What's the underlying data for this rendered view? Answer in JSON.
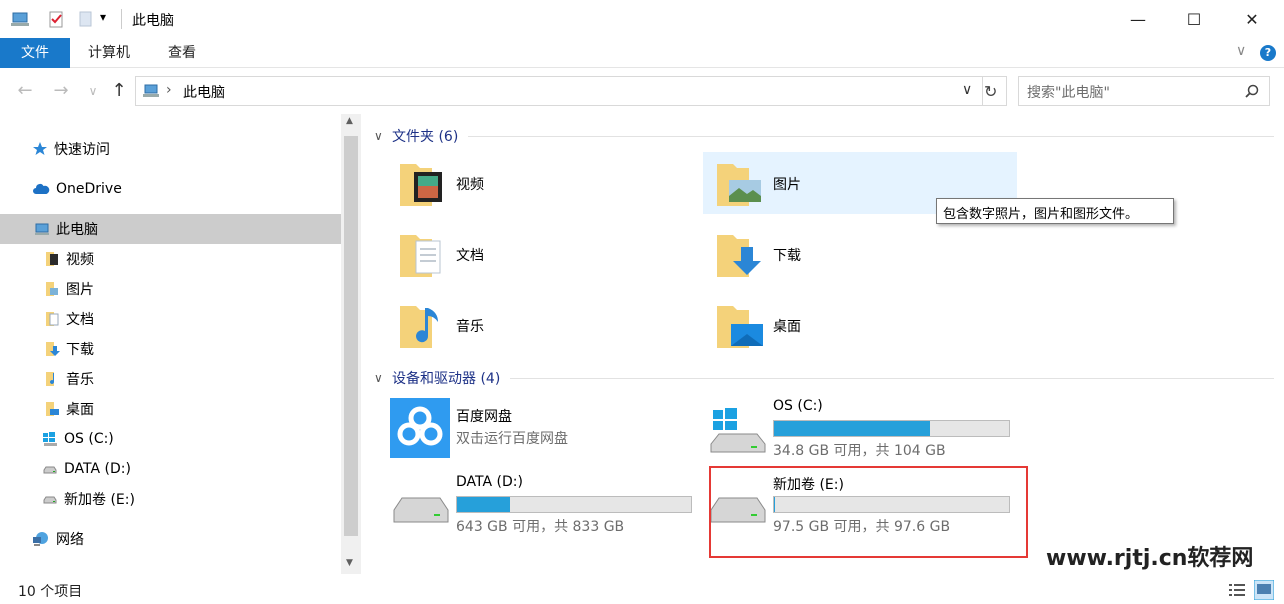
{
  "window": {
    "title": "此电脑",
    "minimize_glyph": "—",
    "maximize_glyph": "☐",
    "close_glyph": "✕",
    "qat_dropdown_glyph": "▾"
  },
  "ribbon": {
    "tabs": [
      "文件",
      "计算机",
      "查看"
    ],
    "expand_glyph": "∨",
    "help_glyph": "?"
  },
  "address": {
    "path": "此电脑",
    "separator": "›",
    "dropdown_glyph": "∨",
    "refresh_glyph": "↻",
    "search_placeholder": "搜索\"此电脑\"",
    "back_glyph": "←",
    "forward_glyph": "→",
    "recent_glyph": "∨",
    "up_glyph": "↑"
  },
  "sidebar": {
    "items": [
      {
        "label": "快速访问",
        "icon": "star-icon"
      },
      {
        "label": "OneDrive",
        "icon": "cloud-icon"
      },
      {
        "label": "此电脑",
        "icon": "computer-icon"
      },
      {
        "label": "视频",
        "icon": "videos-folder-icon"
      },
      {
        "label": "图片",
        "icon": "pictures-folder-icon"
      },
      {
        "label": "文档",
        "icon": "documents-folder-icon"
      },
      {
        "label": "下载",
        "icon": "downloads-folder-icon"
      },
      {
        "label": "音乐",
        "icon": "music-folder-icon"
      },
      {
        "label": "桌面",
        "icon": "desktop-folder-icon"
      },
      {
        "label": "OS (C:)",
        "icon": "windows-drive-icon"
      },
      {
        "label": "DATA (D:)",
        "icon": "drive-icon"
      },
      {
        "label": "新加卷 (E:)",
        "icon": "drive-icon"
      },
      {
        "label": "网络",
        "icon": "network-icon"
      }
    ],
    "scroll_up_glyph": "▲",
    "scroll_down_glyph": "▼"
  },
  "folders_group": {
    "title": "文件夹 (6)",
    "collapse_glyph": "∨",
    "items": [
      {
        "label": "视频",
        "icon": "videos-folder-icon"
      },
      {
        "label": "图片",
        "icon": "pictures-folder-icon"
      },
      {
        "label": "文档",
        "icon": "documents-folder-icon"
      },
      {
        "label": "下载",
        "icon": "downloads-folder-icon"
      },
      {
        "label": "音乐",
        "icon": "music-folder-icon"
      },
      {
        "label": "桌面",
        "icon": "desktop-folder-icon"
      }
    ]
  },
  "devices_group": {
    "title": "设备和驱动器 (4)",
    "collapse_glyph": "∨",
    "baidu": {
      "name": "百度网盘",
      "subtitle": "双击运行百度网盘"
    },
    "drives": [
      {
        "name": "OS (C:)",
        "info": "34.8 GB 可用，共 104 GB",
        "used_fraction": 0.665
      },
      {
        "name": "DATA (D:)",
        "info": "643 GB 可用，共 833 GB",
        "used_fraction": 0.228
      },
      {
        "name": "新加卷 (E:)",
        "info": "97.5 GB 可用，共 97.6 GB",
        "used_fraction": 0.001
      }
    ]
  },
  "tooltip": "包含数字照片，图片和图形文件。",
  "status": {
    "count": "10 个项目"
  },
  "watermark": "www.rjtj.cn软荐网",
  "colors": {
    "accent": "#1979ca",
    "drive_fill": "#26a0da",
    "highlight": "#e53935"
  }
}
